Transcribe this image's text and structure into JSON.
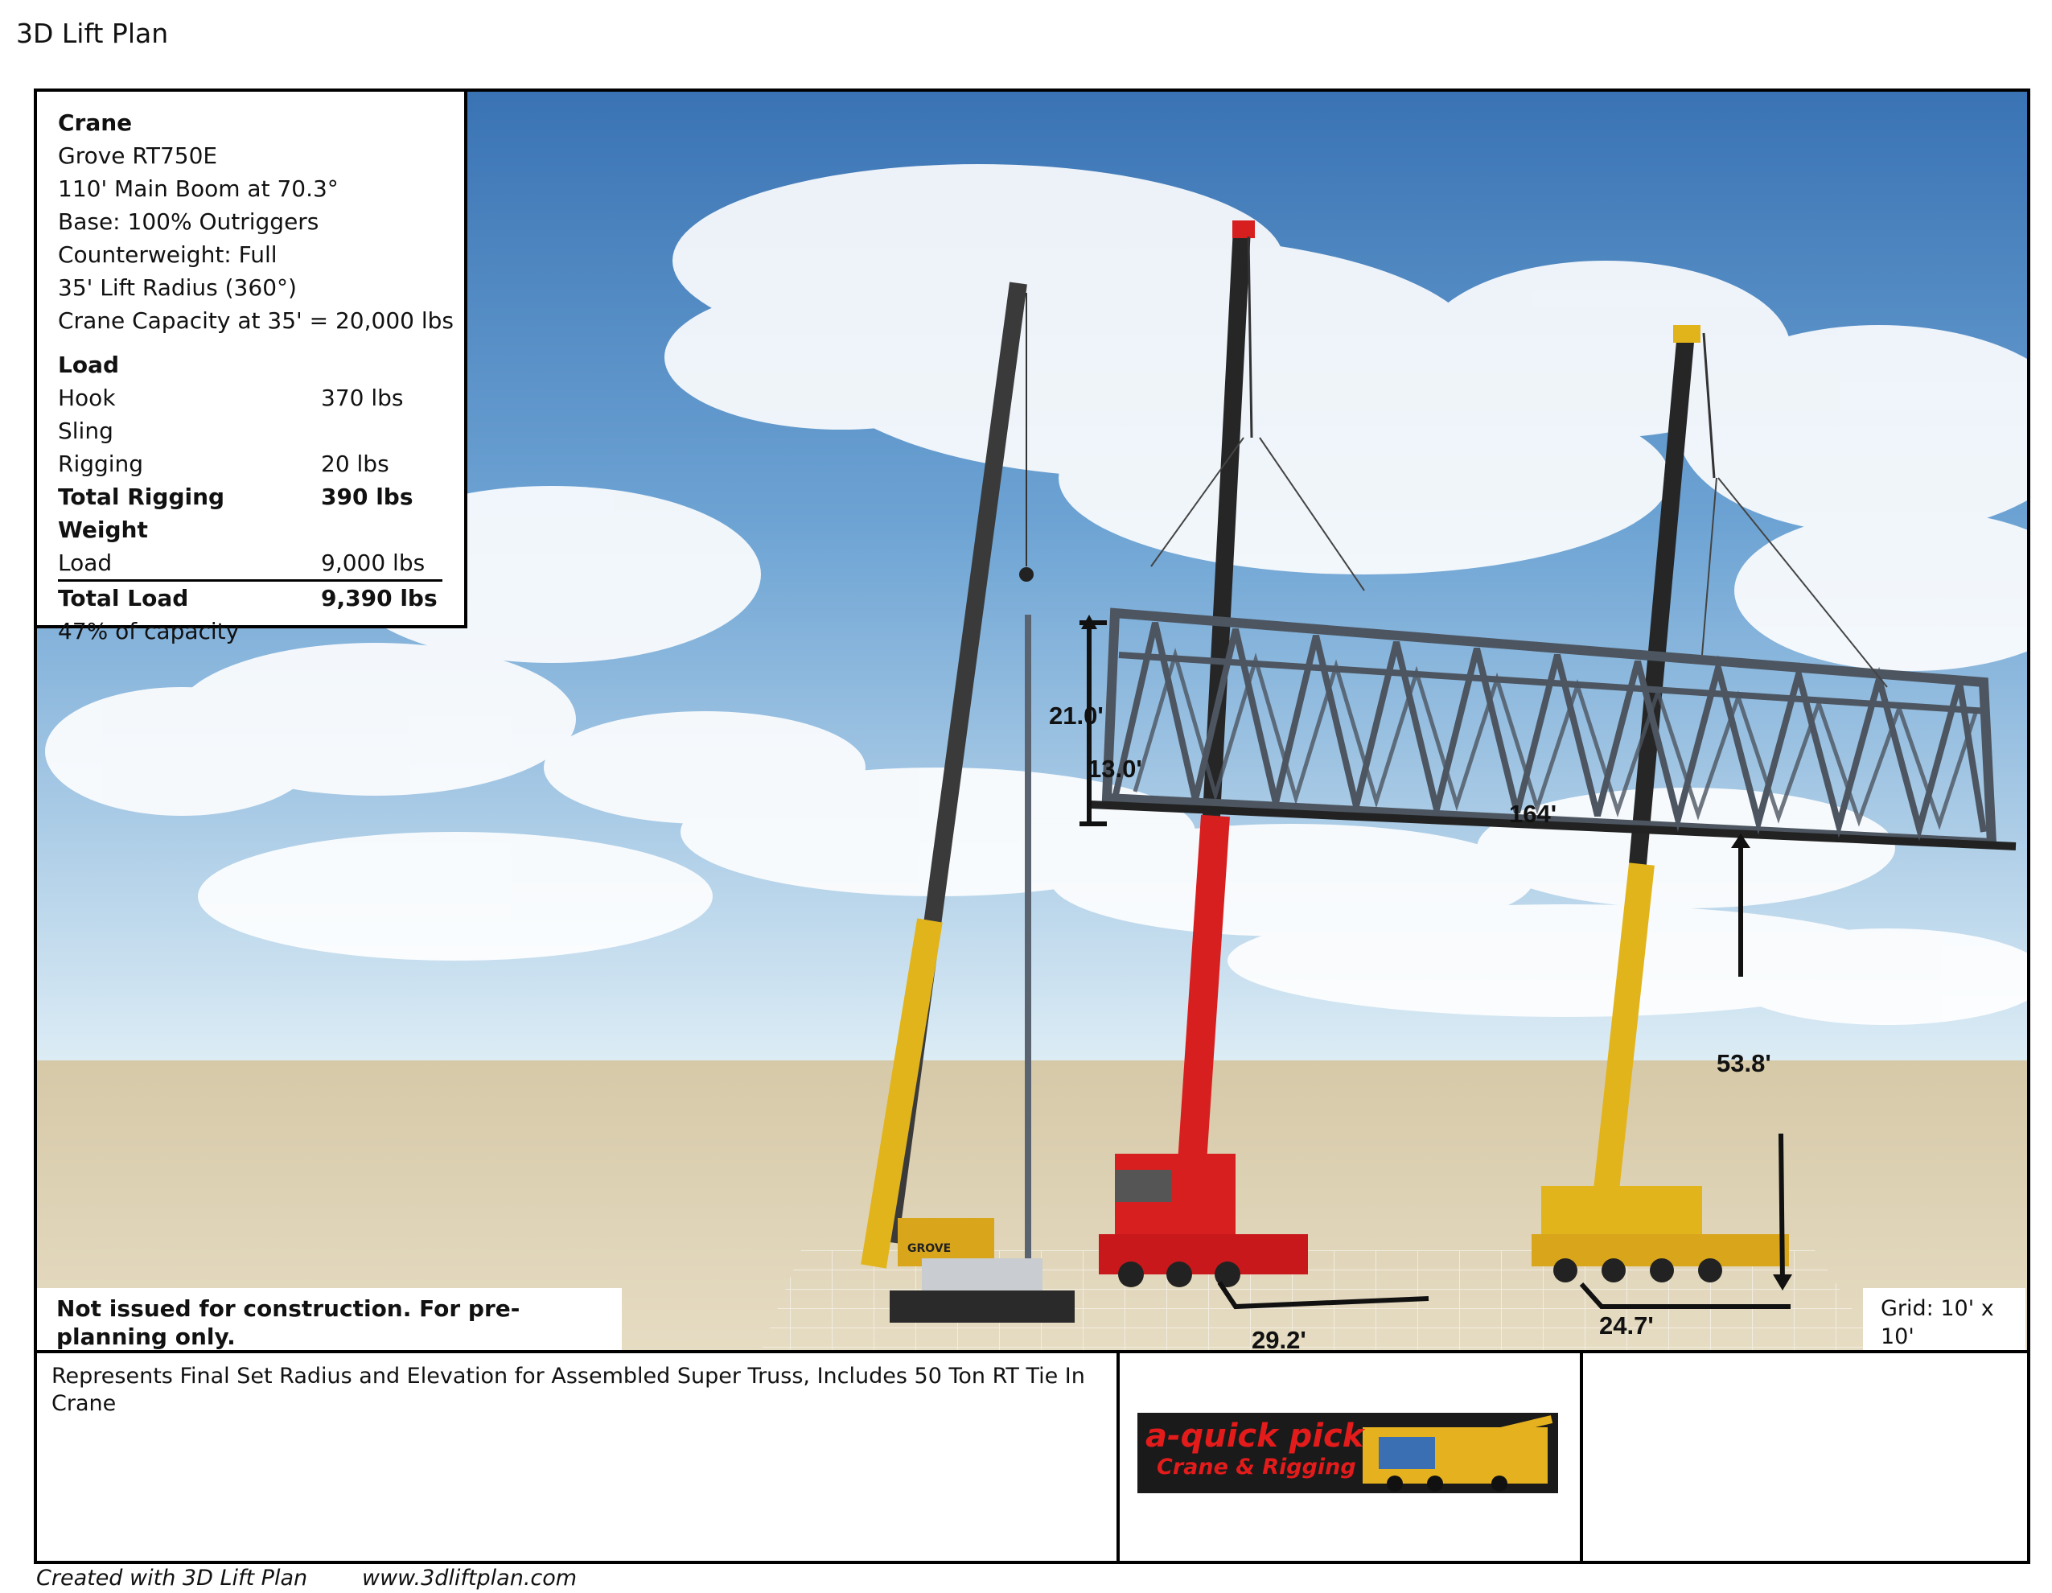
{
  "document_title": "3D Lift Plan",
  "crane": {
    "heading": "Crane",
    "lines": [
      "Grove RT750E",
      "110' Main Boom at 70.3°",
      "Base: 100% Outriggers",
      "Counterweight: Full",
      "35' Lift Radius (360°)",
      "Crane Capacity at 35' = 20,000 lbs"
    ]
  },
  "load": {
    "heading": "Load",
    "hook_label": "Hook",
    "hook_value": "370 lbs",
    "sling_label": "Sling",
    "sling_value": "",
    "rigging_label": "Rigging",
    "rigging_value": "20 lbs",
    "total_rigging_label": "Total Rigging Weight",
    "total_rigging_value": "390 lbs",
    "load_label": "Load",
    "load_value": "9,000 lbs",
    "total_load_label": "Total Load",
    "total_load_value": "9,390 lbs",
    "capacity_pct": "47% of capacity"
  },
  "dimensions": {
    "height_21": "21.0'",
    "height_13": "13.0'",
    "truss_length": "164'",
    "elevation": "53.8'",
    "radius_1": "29.2'",
    "radius_2": "24.7'"
  },
  "notice": "Not issued for construction. For pre-planning only.",
  "grid_label": "Grid: 10' x 10'",
  "description": "Represents Final Set Radius and Elevation for Assembled Super Truss, Includes 50 Ton RT Tie In Crane",
  "logo": {
    "line1": "a-quick pick",
    "line2": "Crane & Rigging"
  },
  "boom_brand": "GROVE",
  "footer": {
    "created_with": "Created with 3D Lift Plan",
    "website": "www.3dliftplan.com"
  },
  "colors": {
    "sky_top": "#3f78b8",
    "sky_bottom": "#d8ecf6",
    "ground": "#d9cba8",
    "crane_yellow": "#e2b41c",
    "crane_red": "#d81f1f",
    "truss": "#4c5560"
  }
}
